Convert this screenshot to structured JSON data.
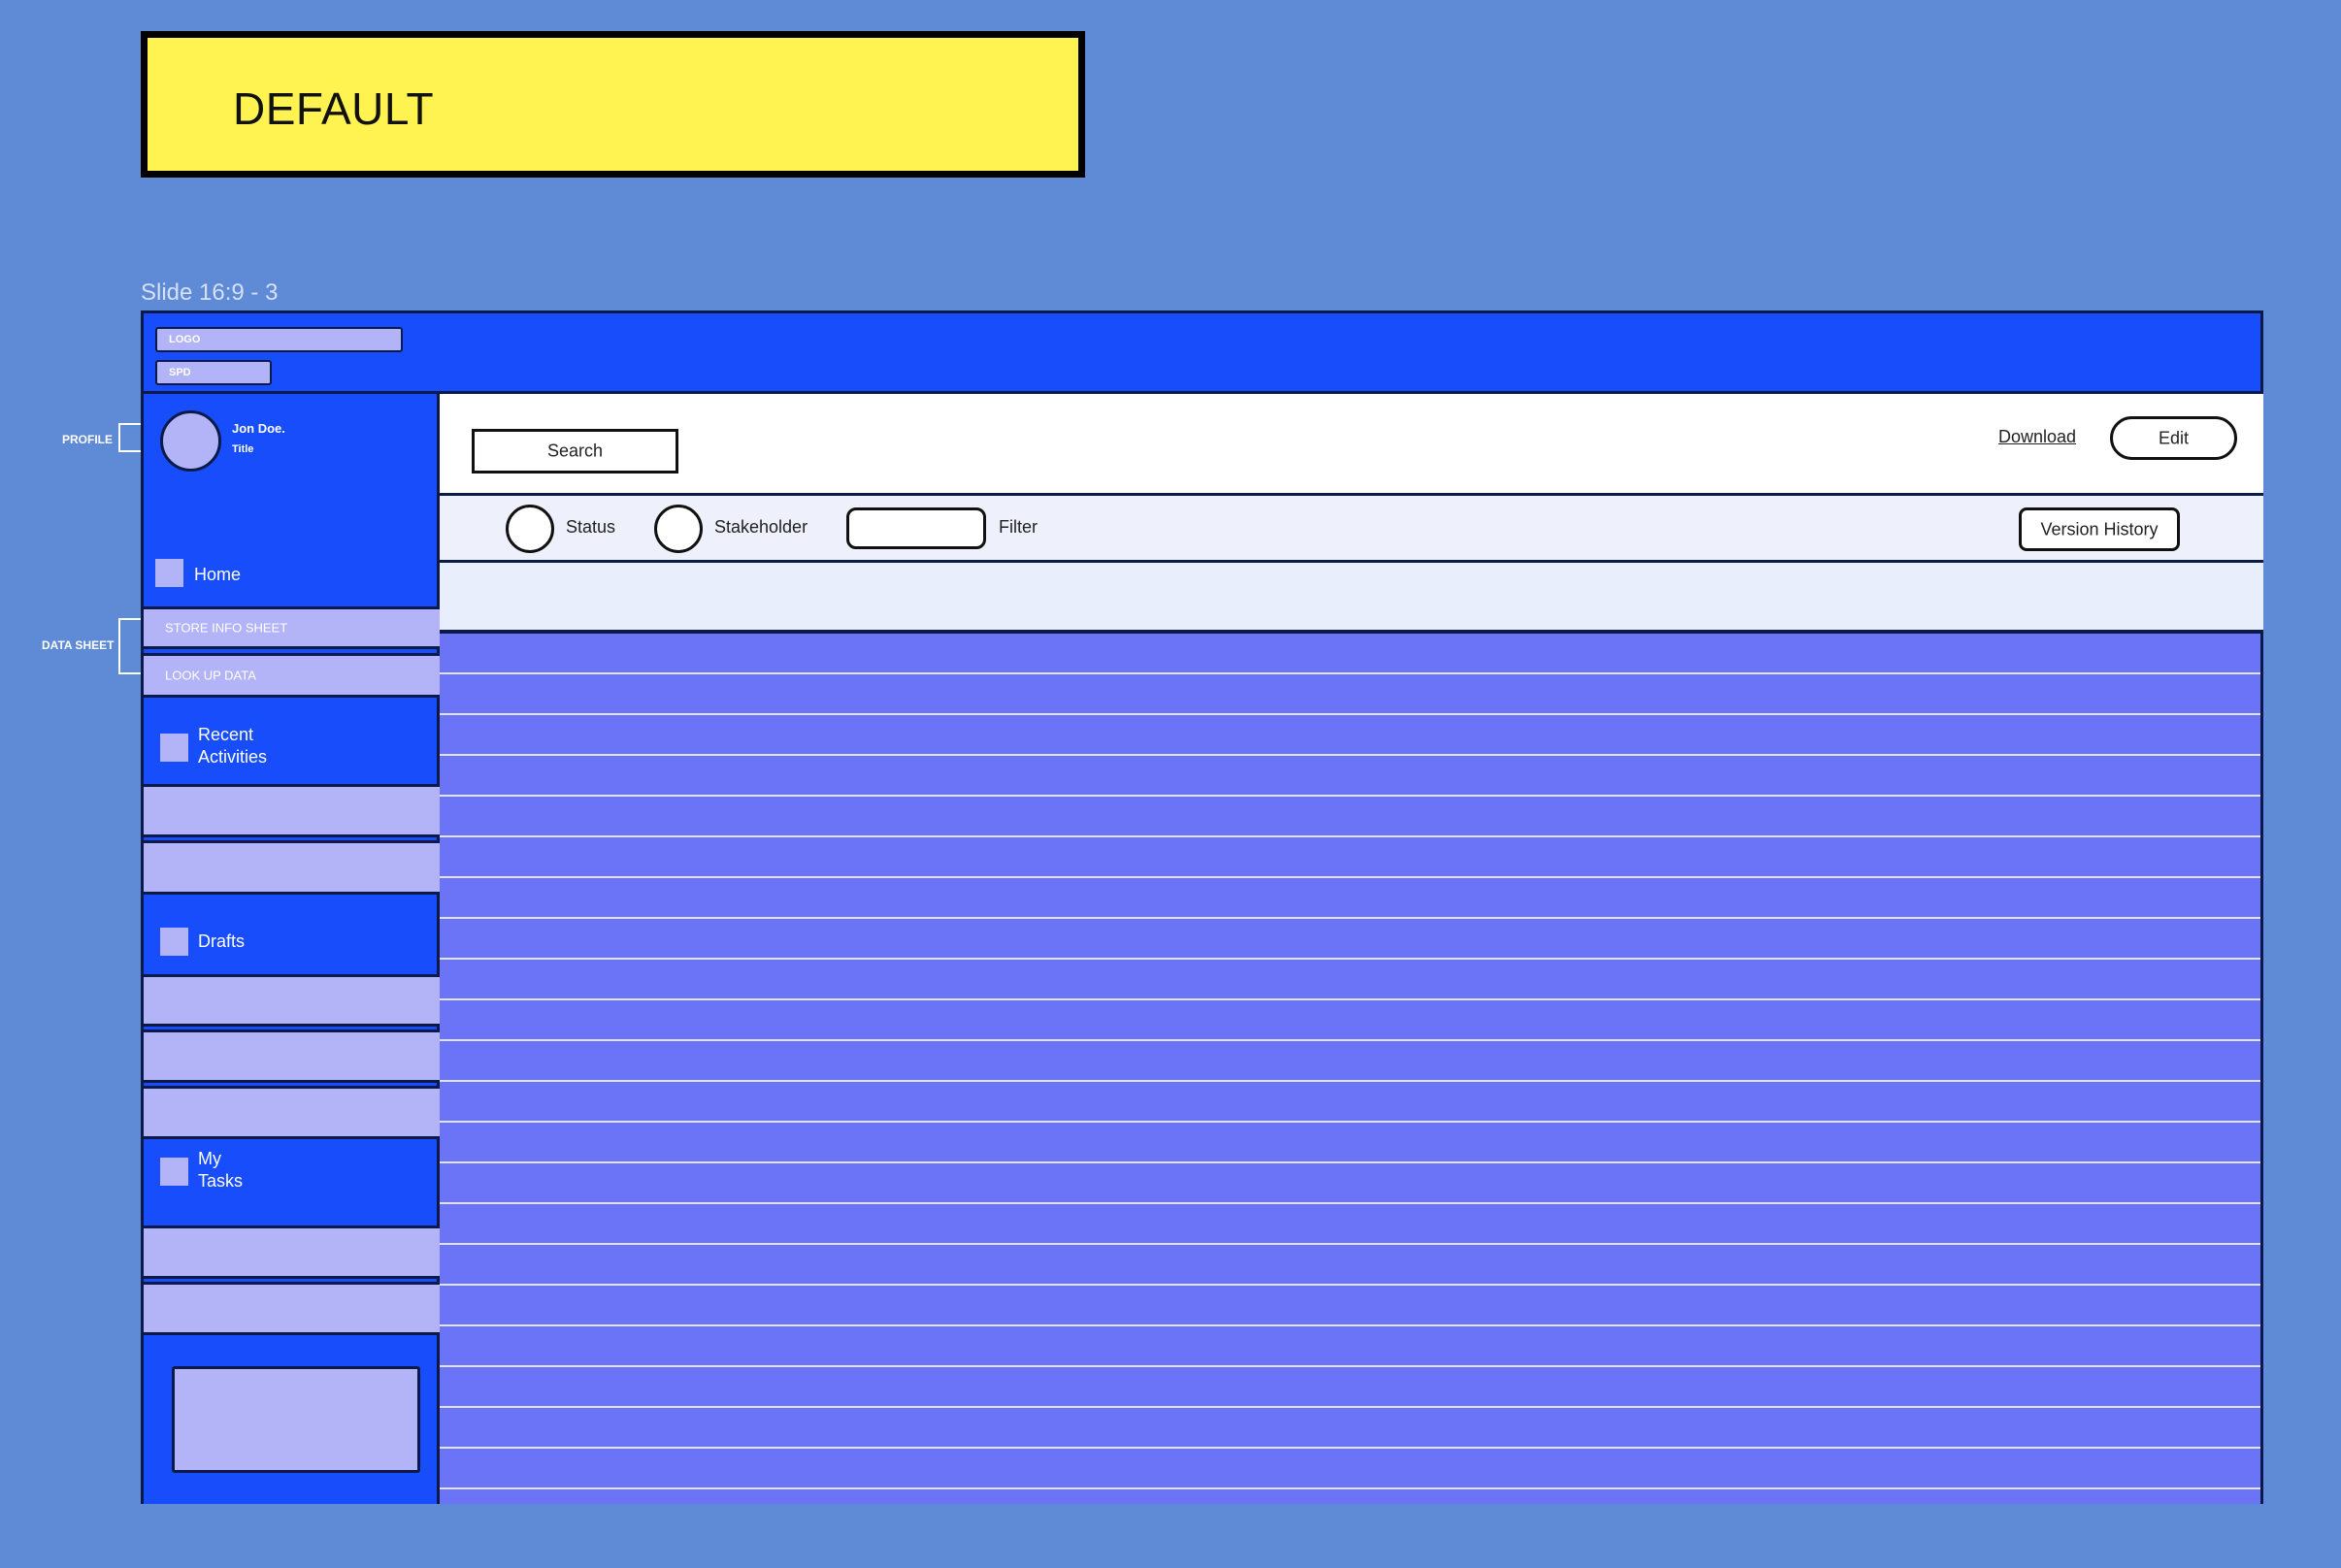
{
  "banner": {
    "label": "DEFAULT"
  },
  "slide_label": "Slide 16:9 - 3",
  "annotations": {
    "profile": "PROFILE",
    "data_sheet": "DATA SHEET"
  },
  "topbar": {
    "logo": "LOGO",
    "spd": "SPD"
  },
  "profile": {
    "name": "Jon Doe.",
    "title": "Title"
  },
  "nav": {
    "home": "Home",
    "store_info_sheet": "STORE INFO SHEET",
    "look_up_data": "LOOK UP DATA",
    "recent_activities_line1": "Recent",
    "recent_activities_line2": "Activities",
    "drafts": "Drafts",
    "my_tasks_line1": "My",
    "my_tasks_line2": "Tasks"
  },
  "toolbar": {
    "search": "Search",
    "download": "Download",
    "edit": "Edit"
  },
  "filters": {
    "status": "Status",
    "stakeholder": "Stakeholder",
    "filter": "Filter",
    "version_history": "Version History"
  },
  "colors": {
    "background": "#5f8ad6",
    "primary_blue": "#174dfa",
    "light_lavender": "#b3b4f7",
    "table_violet": "#6b74f6",
    "banner_yellow": "#fff352"
  }
}
